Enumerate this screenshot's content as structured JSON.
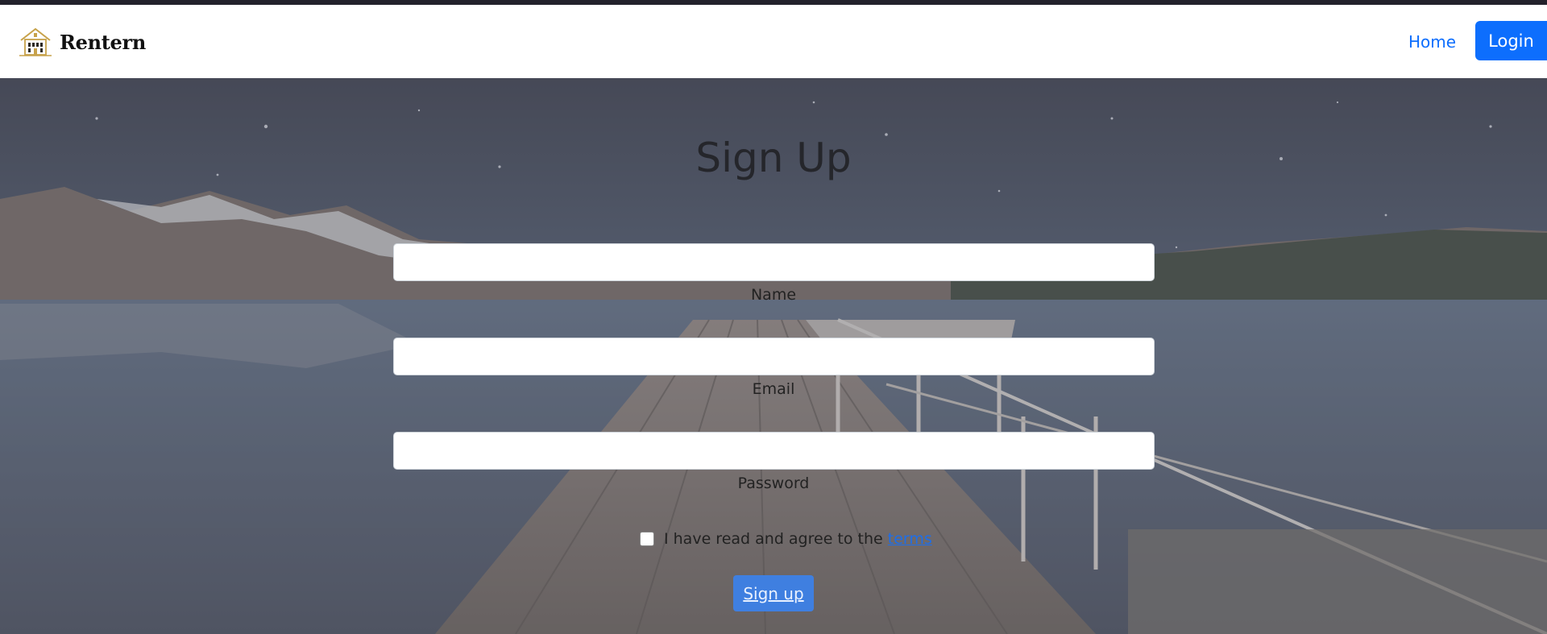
{
  "brand": {
    "name": "Rentern",
    "logo_icon": "building-logo-icon"
  },
  "nav": {
    "home_label": "Home",
    "login_label": "Login"
  },
  "colors": {
    "primary": "#0d6efd",
    "title": "#25262b"
  },
  "form": {
    "title": "Sign Up",
    "fields": [
      {
        "label": "Name",
        "value": ""
      },
      {
        "label": "Email",
        "value": ""
      },
      {
        "label": "Password",
        "value": ""
      }
    ],
    "terms_text": "I have read and agree to the",
    "terms_link": "terms",
    "terms_checked": false,
    "submit_label": "Sign up"
  }
}
